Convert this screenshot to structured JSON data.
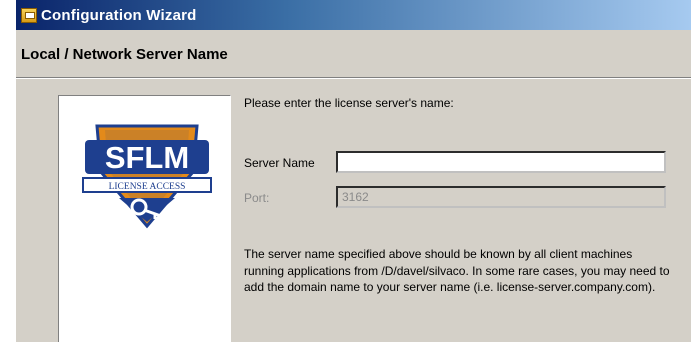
{
  "window": {
    "title": "Configuration Wizard",
    "page_title": "Local / Network Server Name"
  },
  "logo": {
    "wordmark": "SFLM",
    "banner": "LICENSE ACCESS",
    "icon": "key-badge-icon"
  },
  "form": {
    "prompt": "Please enter the license server's name:",
    "server_name": {
      "label": "Server Name",
      "value": ""
    },
    "port": {
      "label": "Port:",
      "value": "3162",
      "enabled": false
    },
    "help_text": "The server name specified above should be known by all client machines running applications from /D/davel/silvaco. In some rare cases, you may need to add the domain name to your server name (i.e. license-server.company.com)."
  },
  "colors": {
    "title_bar_start": "#0a246a",
    "title_bar_end": "#a6caf0",
    "dialog_bg": "#d4d0c8",
    "logo_blue": "#1e3f8f",
    "logo_orange": "#e38a1a"
  }
}
